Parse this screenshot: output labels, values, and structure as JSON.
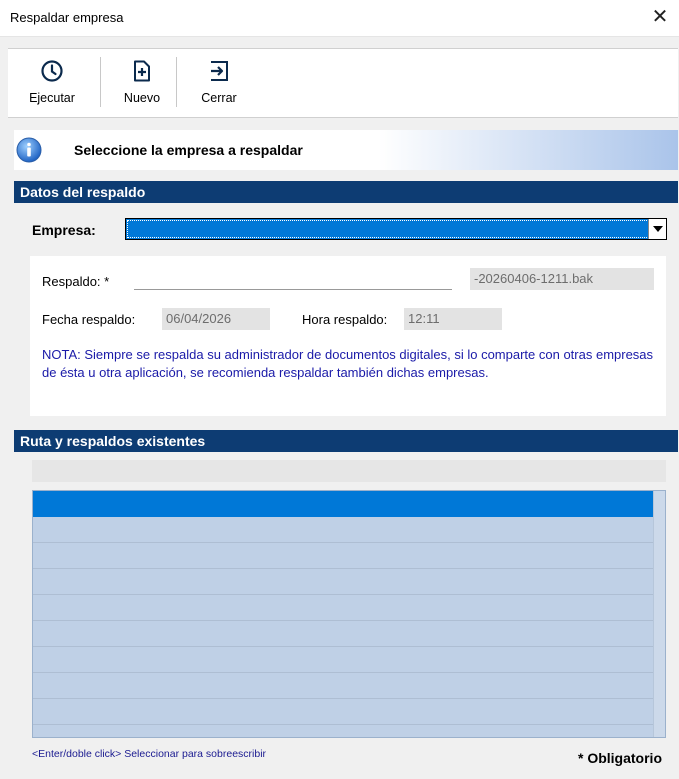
{
  "window": {
    "title": "Respaldar empresa",
    "close_symbol": "✕"
  },
  "toolbar": {
    "buttons": [
      {
        "label": "Ejecutar",
        "icon": "clock-icon"
      },
      {
        "label": "Nuevo",
        "icon": "new-document-icon"
      },
      {
        "label": "Cerrar",
        "icon": "exit-icon"
      }
    ]
  },
  "info": {
    "message": "Seleccione la empresa a respaldar",
    "icon": "info-icon"
  },
  "datos_section": {
    "header": "Datos del respaldo",
    "empresa_label": "Empresa:",
    "empresa_value": ""
  },
  "respaldo": {
    "respaldo_label": "Respaldo: *",
    "respaldo_value": "",
    "filename_suffix": "-20260406-1211.bak",
    "fecha_label": "Fecha respaldo:",
    "fecha_value": "06/04/2026",
    "hora_label": "Hora respaldo:",
    "hora_value": "12:11",
    "nota": "NOTA: Siempre se respalda su administrador de documentos digitales, si lo comparte con otras empresas de ésta u otra aplicación, se recomienda respaldar también dichas empresas."
  },
  "ruta_section": {
    "header": "Ruta y respaldos existentes",
    "path_value": "",
    "rows": [
      "",
      "",
      "",
      "",
      "",
      "",
      "",
      "",
      ""
    ],
    "selected_row": 0
  },
  "footer": {
    "hint": "<Enter/doble click> Seleccionar para sobreescribir",
    "required_note": "* Obligatorio"
  },
  "colors": {
    "accent": "#0078d7",
    "section_header": "#0d3c73",
    "grid_bg": "#bfd0e6",
    "nota_text": "#1a1aa8"
  }
}
